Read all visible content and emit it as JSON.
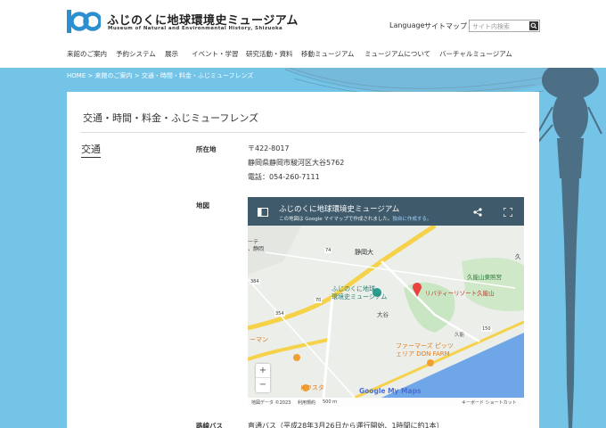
{
  "header": {
    "logo": "100",
    "site_title": "ふじのくに地球環境史ミュージアム",
    "site_subtitle": "Museum of Natural and Environmental History, Shizuoka",
    "language": "Language",
    "sitemap": "サイトマップ",
    "search_placeholder": "サイト内検索"
  },
  "nav": [
    "来館のご案内",
    "予約システム",
    "展示",
    "イベント・学習",
    "研究活動・資料",
    "移動ミュージアム",
    "ミュージアムについて",
    "バーチャルミュージアム"
  ],
  "breadcrumb": "HOME > 来館のご案内 > 交通・時間・料金・ふじミューフレンズ",
  "page": {
    "title": "交通・時間・料金・ふじミューフレンズ",
    "section": "交通",
    "address_label": "所在地",
    "postal": "〒422-8017",
    "address": "静岡県静岡市駿河区大谷5762",
    "phone": "電話：054-260-7111",
    "map_label": "地図",
    "bus_label": "路線バス",
    "bus_value": "直通バス（平成28年3月26日から運行開始、1時間に約1本）"
  },
  "map": {
    "title": "ふじのくに地球環境史ミュージアム",
    "note": "この地図は Google マイマップで作成されました。",
    "note_link": "独自に作成する。",
    "labels": {
      "museum": "ふじのくに地球\n環境史ミュージアム",
      "shizuoka_univ": "静岡大",
      "kunozan": "久能山東照宮",
      "liberty": "リバティーリゾート久能山",
      "otani": "大谷",
      "kunou": "久能",
      "farmers": "ファーマーズ ピッツ\nェリア DON FARM",
      "roadside": "ーマン",
      "dorasata": "ドラスタ",
      "shiryo": "ーテ\n、静岡",
      "ku": "久",
      "r74": "74",
      "r384": "384",
      "r150": "150",
      "r354": "354",
      "r70": "70"
    },
    "zoom_in": "+",
    "zoom_out": "−",
    "footer_left": "地図データ ©2023",
    "footer_terms": "利用規約",
    "footer_scale": "500 m",
    "footer_right": "キーボード ショートカット",
    "google": "Google My Maps"
  },
  "colors": {
    "sky": "#74c4e8",
    "map_bar": "#3f5a6a",
    "road_yellow": "#f5d24a",
    "sea": "#6fa6e8"
  }
}
